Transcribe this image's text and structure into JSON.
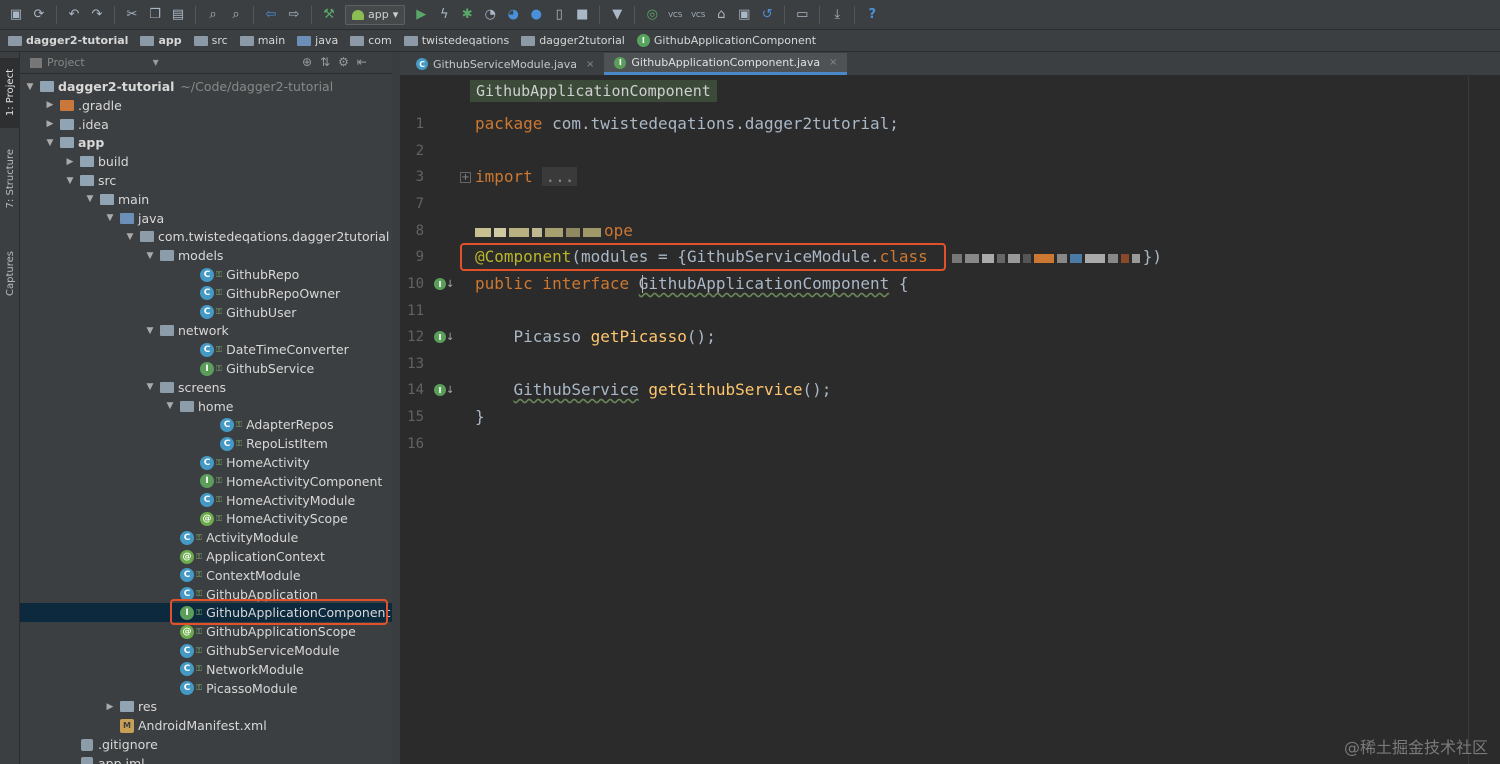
{
  "toolbar": {
    "run_config": "app",
    "icons": [
      "save-all-icon",
      "sync-icon",
      "undo-icon",
      "redo-icon",
      "cut-icon",
      "copy-icon",
      "paste-icon",
      "find-icon",
      "replace-icon",
      "back-icon",
      "forward-icon",
      "make-icon",
      "run-icon",
      "debug-icon",
      "attach-debugger-icon",
      "profile-icon",
      "coverage-icon",
      "stop-icon",
      "sdk-manager-icon",
      "vcs-update-icon",
      "vcs-commit-icon",
      "history-icon",
      "revert-icon",
      "terminal-icon",
      "help-icon"
    ],
    "vcs_label": "VCS",
    "help_label": "?"
  },
  "breadcrumb": [
    {
      "label": "dagger2-tutorial",
      "type": "module"
    },
    {
      "label": "app",
      "type": "module"
    },
    {
      "label": "src",
      "type": "folder"
    },
    {
      "label": "main",
      "type": "folder"
    },
    {
      "label": "java",
      "type": "folder"
    },
    {
      "label": "com",
      "type": "folder"
    },
    {
      "label": "twistedeqations",
      "type": "folder"
    },
    {
      "label": "dagger2tutorial",
      "type": "folder"
    },
    {
      "label": "GithubApplicationComponent",
      "type": "interface"
    }
  ],
  "tool_tabs": {
    "project": "1: Project",
    "structure": "7: Structure",
    "captures": "Captures"
  },
  "project_panel": {
    "title": "Project",
    "tree": [
      {
        "label": "dagger2-tutorial",
        "path": "~/Code/dagger2-tutorial",
        "depth": 0,
        "arrow": "▼",
        "icon": "module",
        "bold": true
      },
      {
        "label": ".gradle",
        "depth": 1,
        "arrow": "▶",
        "icon": "folder-orange"
      },
      {
        "label": ".idea",
        "depth": 1,
        "arrow": "▶",
        "icon": "folder"
      },
      {
        "label": "app",
        "depth": 1,
        "arrow": "▼",
        "icon": "module",
        "bold": true
      },
      {
        "label": "build",
        "depth": 2,
        "arrow": "▶",
        "icon": "folder"
      },
      {
        "label": "src",
        "depth": 2,
        "arrow": "▼",
        "icon": "folder"
      },
      {
        "label": "main",
        "depth": 3,
        "arrow": "▼",
        "icon": "folder"
      },
      {
        "label": "java",
        "depth": 4,
        "arrow": "▼",
        "icon": "folder-blue"
      },
      {
        "label": "com.twistedeqations.dagger2tutorial",
        "depth": 5,
        "arrow": "▼",
        "icon": "package"
      },
      {
        "label": "models",
        "depth": 6,
        "arrow": "▼",
        "icon": "package"
      },
      {
        "label": "GithubRepo",
        "depth": 8,
        "arrow": "",
        "icon": "class"
      },
      {
        "label": "GithubRepoOwner",
        "depth": 8,
        "arrow": "",
        "icon": "class"
      },
      {
        "label": "GithubUser",
        "depth": 8,
        "arrow": "",
        "icon": "class"
      },
      {
        "label": "network",
        "depth": 6,
        "arrow": "▼",
        "icon": "package"
      },
      {
        "label": "DateTimeConverter",
        "depth": 8,
        "arrow": "",
        "icon": "class"
      },
      {
        "label": "GithubService",
        "depth": 8,
        "arrow": "",
        "icon": "interface"
      },
      {
        "label": "screens",
        "depth": 6,
        "arrow": "▼",
        "icon": "package"
      },
      {
        "label": "home",
        "depth": 7,
        "arrow": "▼",
        "icon": "package"
      },
      {
        "label": "AdapterRepos",
        "depth": 9,
        "arrow": "",
        "icon": "class"
      },
      {
        "label": "RepoListItem",
        "depth": 9,
        "arrow": "",
        "icon": "class"
      },
      {
        "label": "HomeActivity",
        "depth": 8,
        "arrow": "",
        "icon": "class"
      },
      {
        "label": "HomeActivityComponent",
        "depth": 8,
        "arrow": "",
        "icon": "interface"
      },
      {
        "label": "HomeActivityModule",
        "depth": 8,
        "arrow": "",
        "icon": "class"
      },
      {
        "label": "HomeActivityScope",
        "depth": 8,
        "arrow": "",
        "icon": "annotation"
      },
      {
        "label": "ActivityModule",
        "depth": 7,
        "arrow": "",
        "icon": "class"
      },
      {
        "label": "ApplicationContext",
        "depth": 7,
        "arrow": "",
        "icon": "annotation"
      },
      {
        "label": "ContextModule",
        "depth": 7,
        "arrow": "",
        "icon": "class"
      },
      {
        "label": "GithubApplication",
        "depth": 7,
        "arrow": "",
        "icon": "class"
      },
      {
        "label": "GithubApplicationComponent",
        "depth": 7,
        "arrow": "",
        "icon": "interface",
        "selected": true
      },
      {
        "label": "GithubApplicationScope",
        "depth": 7,
        "arrow": "",
        "icon": "annotation"
      },
      {
        "label": "GithubServiceModule",
        "depth": 7,
        "arrow": "",
        "icon": "class"
      },
      {
        "label": "NetworkModule",
        "depth": 7,
        "arrow": "",
        "icon": "class"
      },
      {
        "label": "PicassoModule",
        "depth": 7,
        "arrow": "",
        "icon": "class"
      },
      {
        "label": "res",
        "depth": 4,
        "arrow": "▶",
        "icon": "folder"
      },
      {
        "label": "AndroidManifest.xml",
        "depth": 4,
        "arrow": "",
        "icon": "xml"
      },
      {
        "label": ".gitignore",
        "depth": 2,
        "arrow": "",
        "icon": "file"
      },
      {
        "label": "app.iml",
        "depth": 2,
        "arrow": "",
        "icon": "file"
      }
    ]
  },
  "editor": {
    "tabs": [
      {
        "label": "GithubServiceModule.java",
        "active": false,
        "icon": "class"
      },
      {
        "label": "GithubApplicationComponent.java",
        "active": true,
        "icon": "interface"
      }
    ],
    "class_crumb": "GithubApplicationComponent",
    "line_numbers": [
      "1",
      "2",
      "3",
      "7",
      "8",
      "9",
      "10",
      "11",
      "12",
      "13",
      "14",
      "15",
      "16"
    ],
    "code": {
      "l1_kw": "package",
      "l1_rest": " com.twistedeqations.dagger2tutorial;",
      "l3_kw": "import",
      "l3_fold": "...",
      "l8_partial": "ope",
      "l9_at": "@",
      "l9_ann": "Component",
      "l9_rest": "(modules = {GithubServiceModule.",
      "l9_kw": "class",
      "l9_end": "})",
      "l10_kw": "public interface",
      "l10_name": "GithubApplicationComponent",
      "l10_brace": " {",
      "l12_type": "Picasso ",
      "l12_fn": "getPicasso",
      "l12_end": "();",
      "l14_type": "GithubService",
      "l14_fn": "getGithubService",
      "l14_end": "();",
      "l15": "}"
    },
    "gutter_icon_letter": "I",
    "gutter_arrow": "↓"
  },
  "watermark": "@稀土掘金技术社区",
  "colors": {
    "keyword": "#cc7832",
    "annotation": "#bbb529",
    "method": "#ffc66d",
    "text": "#a9b7c6",
    "highlight_box": "#e2512a",
    "selection": "#0d293e"
  }
}
